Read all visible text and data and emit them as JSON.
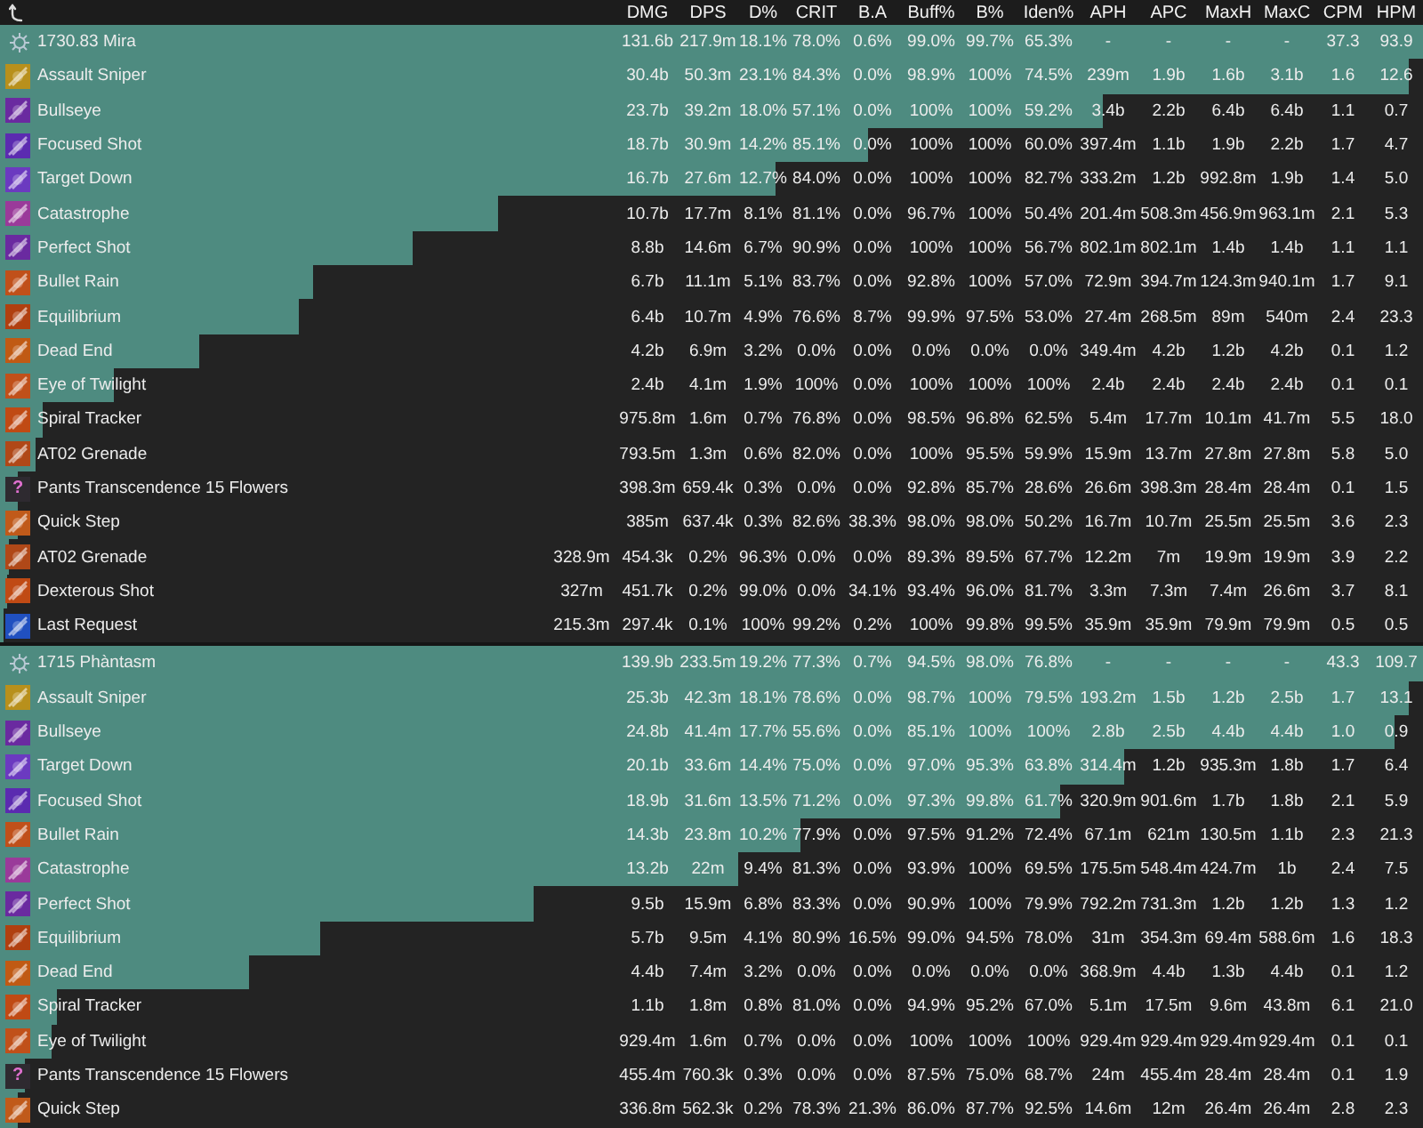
{
  "columns": [
    "DMG",
    "DPS",
    "D%",
    "CRIT",
    "B.A",
    "Buff%",
    "B%",
    "Iden%",
    "APH",
    "APC",
    "MaxH",
    "MaxC",
    "CPM",
    "HPM"
  ],
  "groups": [
    {
      "rows": [
        {
          "kind": "player",
          "name": "1730.83 Mira",
          "level": 1,
          "cells": [
            "131.6b",
            "217.9m",
            "18.1%",
            "78.0%",
            "0.6%",
            "99.0%",
            "99.7%",
            "65.3%",
            "-",
            "-",
            "-",
            "-",
            "37.3",
            "93.9"
          ]
        },
        {
          "kind": "skill",
          "name": "Assault Sniper",
          "color": "#b8901c",
          "level": 0.99,
          "cells": [
            "30.4b",
            "50.3m",
            "23.1%",
            "84.3%",
            "0.0%",
            "98.9%",
            "100%",
            "74.5%",
            "239m",
            "1.9b",
            "1.6b",
            "3.1b",
            "1.6",
            "12.6"
          ]
        },
        {
          "kind": "skill",
          "name": "Bullseye",
          "color": "#6a2aa0",
          "level": 0.775,
          "cells": [
            "23.7b",
            "39.2m",
            "18.0%",
            "57.1%",
            "0.0%",
            "100%",
            "100%",
            "59.2%",
            "3.4b",
            "2.2b",
            "6.4b",
            "6.4b",
            "1.1",
            "0.7"
          ]
        },
        {
          "kind": "skill",
          "name": "Focused Shot",
          "color": "#5b2bb0",
          "level": 0.61,
          "cells": [
            "18.7b",
            "30.9m",
            "14.2%",
            "85.1%",
            "0.0%",
            "100%",
            "100%",
            "60.0%",
            "397.4m",
            "1.1b",
            "1.9b",
            "2.2b",
            "1.7",
            "4.7"
          ]
        },
        {
          "kind": "skill",
          "name": "Target Down",
          "color": "#6b3ac0",
          "level": 0.545,
          "cells": [
            "16.7b",
            "27.6m",
            "12.7%",
            "84.0%",
            "0.0%",
            "100%",
            "100%",
            "82.7%",
            "333.2m",
            "1.2b",
            "992.8m",
            "1.9b",
            "1.4",
            "5.0"
          ]
        },
        {
          "kind": "skill",
          "name": "Catastrophe",
          "color": "#9a3a9a",
          "level": 0.35,
          "cells": [
            "10.7b",
            "17.7m",
            "8.1%",
            "81.1%",
            "0.0%",
            "96.7%",
            "100%",
            "50.4%",
            "201.4m",
            "508.3m",
            "456.9m",
            "963.1m",
            "2.1",
            "5.3"
          ]
        },
        {
          "kind": "skill",
          "name": "Perfect Shot",
          "color": "#6a2aa0",
          "level": 0.29,
          "cells": [
            "8.8b",
            "14.6m",
            "6.7%",
            "90.9%",
            "0.0%",
            "100%",
            "100%",
            "56.7%",
            "802.1m",
            "802.1m",
            "1.4b",
            "1.4b",
            "1.1",
            "1.1"
          ]
        },
        {
          "kind": "skill",
          "name": "Bullet Rain",
          "color": "#c0501a",
          "level": 0.22,
          "cells": [
            "6.7b",
            "11.1m",
            "5.1%",
            "83.7%",
            "0.0%",
            "92.8%",
            "100%",
            "57.0%",
            "72.9m",
            "394.7m",
            "124.3m",
            "940.1m",
            "1.7",
            "9.1"
          ]
        },
        {
          "kind": "skill",
          "name": "Equilibrium",
          "color": "#b04010",
          "level": 0.21,
          "cells": [
            "6.4b",
            "10.7m",
            "4.9%",
            "76.6%",
            "8.7%",
            "99.9%",
            "97.5%",
            "53.0%",
            "27.4m",
            "268.5m",
            "89m",
            "540m",
            "2.4",
            "23.3"
          ]
        },
        {
          "kind": "skill",
          "name": "Dead End",
          "color": "#c05a14",
          "level": 0.14,
          "cells": [
            "4.2b",
            "6.9m",
            "3.2%",
            "0.0%",
            "0.0%",
            "0.0%",
            "0.0%",
            "0.0%",
            "349.4m",
            "4.2b",
            "1.2b",
            "4.2b",
            "0.1",
            "1.2"
          ]
        },
        {
          "kind": "skill",
          "name": "Eye of Twilight",
          "color": "#c0501a",
          "level": 0.08,
          "cells": [
            "2.4b",
            "4.1m",
            "1.9%",
            "100%",
            "0.0%",
            "100%",
            "100%",
            "100%",
            "2.4b",
            "2.4b",
            "2.4b",
            "2.4b",
            "0.1",
            "0.1"
          ]
        },
        {
          "kind": "skill",
          "name": "Spiral Tracker",
          "color": "#c04a14",
          "level": 0.03,
          "cells": [
            "975.8m",
            "1.6m",
            "0.7%",
            "76.8%",
            "0.0%",
            "98.5%",
            "96.8%",
            "62.5%",
            "5.4m",
            "17.7m",
            "10.1m",
            "41.7m",
            "5.5",
            "18.0"
          ]
        },
        {
          "kind": "skill",
          "name": "AT02 Grenade",
          "color": "#b04818",
          "level": 0.025,
          "cells": [
            "793.5m",
            "1.3m",
            "0.6%",
            "82.0%",
            "0.0%",
            "100%",
            "95.5%",
            "59.9%",
            "15.9m",
            "13.7m",
            "27.8m",
            "27.8m",
            "5.8",
            "5.0"
          ]
        },
        {
          "kind": "skill",
          "name": "Pants Transcendence 15 Flowers",
          "color": "#2e2a30",
          "icon_text": "?",
          "level": 0.013,
          "cells": [
            "398.3m",
            "659.4k",
            "0.3%",
            "0.0%",
            "0.0%",
            "92.8%",
            "85.7%",
            "28.6%",
            "26.6m",
            "398.3m",
            "28.4m",
            "28.4m",
            "0.1",
            "1.5"
          ]
        },
        {
          "kind": "skill",
          "name": "Quick Step",
          "color": "#c05a1a",
          "level": 0.012,
          "cells": [
            "385m",
            "637.4k",
            "0.3%",
            "82.6%",
            "38.3%",
            "98.0%",
            "98.0%",
            "50.2%",
            "16.7m",
            "10.7m",
            "25.5m",
            "25.5m",
            "3.6",
            "2.3"
          ]
        },
        {
          "kind": "skill",
          "name": "AT02 Grenade",
          "color": "#b04818",
          "level": 0.006,
          "cells": [
            "328.9m",
            "454.3k",
            "0.2%",
            "96.3%",
            "0.0%",
            "0.0%",
            "89.3%",
            "89.5%",
            "67.7%",
            "12.2m",
            "7m",
            "19.9m",
            "19.9m",
            "3.9",
            "2.2"
          ]
        },
        {
          "kind": "skill",
          "name": "Dexterous Shot",
          "color": "#c04a14",
          "level": 0.005,
          "cells": [
            "327m",
            "451.7k",
            "0.2%",
            "99.0%",
            "0.0%",
            "34.1%",
            "93.4%",
            "96.0%",
            "81.7%",
            "3.3m",
            "7.3m",
            "7.4m",
            "26.6m",
            "3.7",
            "8.1"
          ]
        },
        {
          "kind": "skill",
          "name": "Last Request",
          "color": "#2050c0",
          "level": 0.003,
          "cells": [
            "215.3m",
            "297.4k",
            "0.1%",
            "100%",
            "99.2%",
            "0.2%",
            "100%",
            "99.8%",
            "99.5%",
            "35.9m",
            "35.9m",
            "79.9m",
            "79.9m",
            "0.5",
            "0.5"
          ]
        }
      ]
    },
    {
      "rows": [
        {
          "kind": "player",
          "name": "1715 Phàntasm",
          "level": 1,
          "cells": [
            "139.9b",
            "233.5m",
            "19.2%",
            "77.3%",
            "0.7%",
            "94.5%",
            "98.0%",
            "76.8%",
            "-",
            "-",
            "-",
            "-",
            "43.3",
            "109.7"
          ]
        },
        {
          "kind": "skill",
          "name": "Assault Sniper",
          "color": "#b8901c",
          "level": 0.99,
          "cells": [
            "25.3b",
            "42.3m",
            "18.1%",
            "78.6%",
            "0.0%",
            "98.7%",
            "100%",
            "79.5%",
            "193.2m",
            "1.5b",
            "1.2b",
            "2.5b",
            "1.7",
            "13.1"
          ]
        },
        {
          "kind": "skill",
          "name": "Bullseye",
          "color": "#6a2aa0",
          "level": 0.98,
          "cells": [
            "24.8b",
            "41.4m",
            "17.7%",
            "55.6%",
            "0.0%",
            "85.1%",
            "100%",
            "100%",
            "2.8b",
            "2.5b",
            "4.4b",
            "4.4b",
            "1.0",
            "0.9"
          ]
        },
        {
          "kind": "skill",
          "name": "Target Down",
          "color": "#6b3ac0",
          "level": 0.79,
          "cells": [
            "20.1b",
            "33.6m",
            "14.4%",
            "75.0%",
            "0.0%",
            "97.0%",
            "95.3%",
            "63.8%",
            "314.4m",
            "1.2b",
            "935.3m",
            "1.8b",
            "1.7",
            "6.4"
          ]
        },
        {
          "kind": "skill",
          "name": "Focused Shot",
          "color": "#5b2bb0",
          "level": 0.745,
          "cells": [
            "18.9b",
            "31.6m",
            "13.5%",
            "71.2%",
            "0.0%",
            "97.3%",
            "99.8%",
            "61.7%",
            "320.9m",
            "901.6m",
            "1.7b",
            "1.8b",
            "2.1",
            "5.9"
          ]
        },
        {
          "kind": "skill",
          "name": "Bullet Rain",
          "color": "#c0501a",
          "level": 0.562,
          "cells": [
            "14.3b",
            "23.8m",
            "10.2%",
            "77.9%",
            "0.0%",
            "97.5%",
            "91.2%",
            "72.4%",
            "67.1m",
            "621m",
            "130.5m",
            "1.1b",
            "2.3",
            "21.3"
          ]
        },
        {
          "kind": "skill",
          "name": "Catastrophe",
          "color": "#9a3a9a",
          "level": 0.519,
          "cells": [
            "13.2b",
            "22m",
            "9.4%",
            "81.3%",
            "0.0%",
            "93.9%",
            "100%",
            "69.5%",
            "175.5m",
            "548.4m",
            "424.7m",
            "1b",
            "2.4",
            "7.5"
          ]
        },
        {
          "kind": "skill",
          "name": "Perfect Shot",
          "color": "#6a2aa0",
          "level": 0.375,
          "cells": [
            "9.5b",
            "15.9m",
            "6.8%",
            "83.3%",
            "0.0%",
            "90.9%",
            "100%",
            "79.9%",
            "792.2m",
            "731.3m",
            "1.2b",
            "1.2b",
            "1.3",
            "1.2"
          ]
        },
        {
          "kind": "skill",
          "name": "Equilibrium",
          "color": "#b04010",
          "level": 0.225,
          "cells": [
            "5.7b",
            "9.5m",
            "4.1%",
            "80.9%",
            "16.5%",
            "99.0%",
            "94.5%",
            "78.0%",
            "31m",
            "354.3m",
            "69.4m",
            "588.6m",
            "1.6",
            "18.3"
          ]
        },
        {
          "kind": "skill",
          "name": "Dead End",
          "color": "#c05a14",
          "level": 0.175,
          "cells": [
            "4.4b",
            "7.4m",
            "3.2%",
            "0.0%",
            "0.0%",
            "0.0%",
            "0.0%",
            "0.0%",
            "368.9m",
            "4.4b",
            "1.3b",
            "4.4b",
            "0.1",
            "1.2"
          ]
        },
        {
          "kind": "skill",
          "name": "Spiral Tracker",
          "color": "#c04a14",
          "level": 0.04,
          "cells": [
            "1.1b",
            "1.8m",
            "0.8%",
            "81.0%",
            "0.0%",
            "94.9%",
            "95.2%",
            "67.0%",
            "5.1m",
            "17.5m",
            "9.6m",
            "43.8m",
            "6.1",
            "21.0"
          ]
        },
        {
          "kind": "skill",
          "name": "Eye of Twilight",
          "color": "#c0501a",
          "level": 0.036,
          "cells": [
            "929.4m",
            "1.6m",
            "0.7%",
            "0.0%",
            "0.0%",
            "100%",
            "100%",
            "100%",
            "929.4m",
            "929.4m",
            "929.4m",
            "929.4m",
            "0.1",
            "0.1"
          ]
        },
        {
          "kind": "skill",
          "name": "Pants Transcendence 15 Flowers",
          "color": "#2e2a30",
          "icon_text": "?",
          "level": 0.018,
          "cells": [
            "455.4m",
            "760.3k",
            "0.3%",
            "0.0%",
            "0.0%",
            "87.5%",
            "75.0%",
            "68.7%",
            "24m",
            "455.4m",
            "28.4m",
            "28.4m",
            "0.1",
            "1.9"
          ]
        },
        {
          "kind": "skill",
          "name": "Quick Step",
          "color": "#c05a1a",
          "level": 0.013,
          "cells": [
            "336.8m",
            "562.3k",
            "0.2%",
            "78.3%",
            "21.3%",
            "86.0%",
            "87.7%",
            "92.5%",
            "14.6m",
            "12m",
            "26.4m",
            "26.4m",
            "2.8",
            "2.3"
          ]
        }
      ]
    }
  ]
}
